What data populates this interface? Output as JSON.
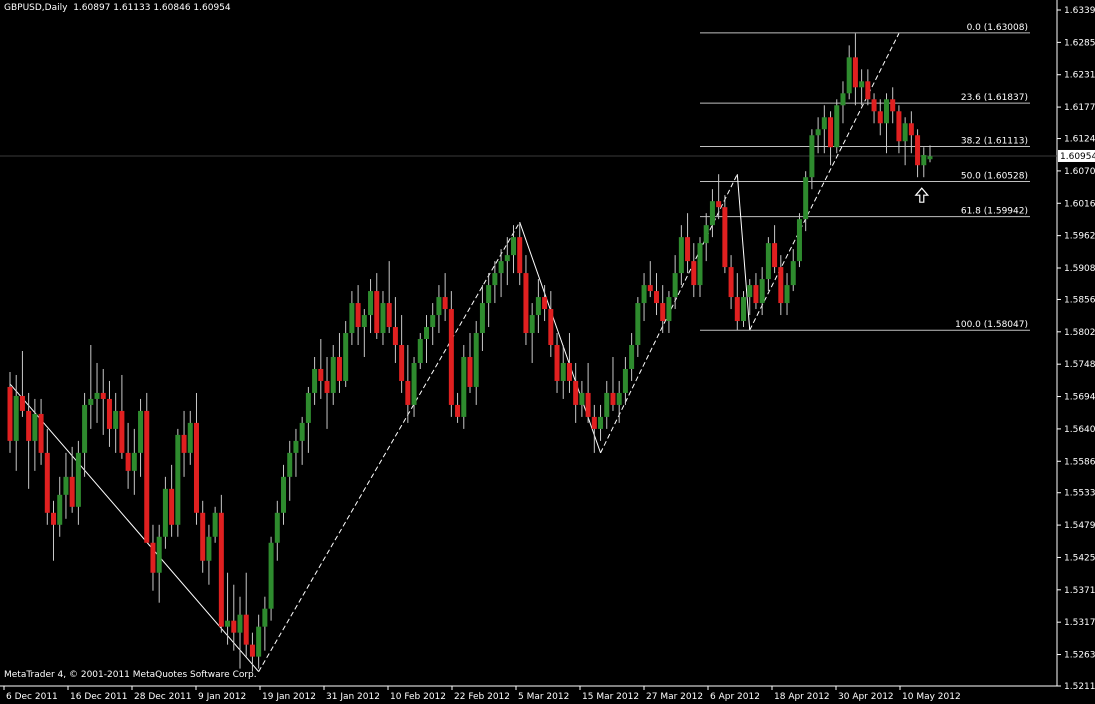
{
  "header": {
    "symbol": "GBPUSD,Daily",
    "ohlc": "1.60897 1.61133 1.60846 1.60954"
  },
  "footer": {
    "copyright": "MetaTrader 4, © 2001-2011 MetaQuotes Software Corp."
  },
  "colors": {
    "background": "#000000",
    "bull": "#2e8b2e",
    "bear": "#e02020",
    "wick": "#c8c8c8",
    "axis": "#ffffff",
    "fib": "#c0c0c0",
    "zigzag": "#ffffff",
    "price_line": "#3a3a3a"
  },
  "chart_data": {
    "type": "candlestick",
    "symbol": "GBPUSD",
    "timeframe": "Daily",
    "grid": false,
    "ylim": [
      1.5211,
      1.6339
    ],
    "y_ticks": [
      "1.63390",
      "1.62850",
      "1.62310",
      "1.61770",
      "1.61245",
      "1.60705",
      "1.60165",
      "1.59625",
      "1.59085",
      "1.58560",
      "1.58020",
      "1.57480",
      "1.56940",
      "1.56400",
      "1.55860",
      "1.55335",
      "1.54795",
      "1.54255",
      "1.53715",
      "1.53175",
      "1.52635",
      "1.52110"
    ],
    "x_ticks": [
      "6 Dec 2011",
      "16 Dec 2011",
      "28 Dec 2011",
      "9 Jan 2012",
      "19 Jan 2012",
      "31 Jan 2012",
      "10 Feb 2012",
      "22 Feb 2012",
      "5 Mar 2012",
      "15 Mar 2012",
      "27 Mar 2012",
      "6 Apr 2012",
      "18 Apr 2012",
      "30 Apr 2012",
      "10 May 2012"
    ],
    "current_price": "1.60954",
    "fibonacci": [
      {
        "label": "0.0 (1.63008)",
        "price": 1.63008
      },
      {
        "label": "23.6 (1.61837)",
        "price": 1.61837
      },
      {
        "label": "38.2 (1.61113)",
        "price": 1.61113
      },
      {
        "label": "50.0 (1.60528)",
        "price": 1.60528
      },
      {
        "label": "61.8 (1.59942)",
        "price": 1.59942
      },
      {
        "label": "100.0 (1.58047)",
        "price": 1.58047
      }
    ],
    "zigzag": [
      {
        "bar": 0,
        "price": 1.5715
      },
      {
        "bar": 40,
        "price": 1.5235
      },
      {
        "bar": 82,
        "price": 1.5985
      },
      {
        "bar": 95,
        "price": 1.56
      },
      {
        "bar": 117,
        "price": 1.6065
      },
      {
        "bar": 119,
        "price": 1.5805
      },
      {
        "bar": 143,
        "price": 1.63
      }
    ],
    "candles": [
      [
        1.571,
        1.5735,
        1.56,
        1.562
      ],
      [
        1.562,
        1.573,
        1.557,
        1.5695
      ],
      [
        1.5695,
        1.577,
        1.566,
        1.567
      ],
      [
        1.567,
        1.57,
        1.554,
        1.562
      ],
      [
        1.562,
        1.569,
        1.557,
        1.5665
      ],
      [
        1.5665,
        1.569,
        1.558,
        1.56
      ],
      [
        1.56,
        1.564,
        1.548,
        1.55
      ],
      [
        1.55,
        1.552,
        1.542,
        1.548
      ],
      [
        1.548,
        1.556,
        1.546,
        1.553
      ],
      [
        1.553,
        1.56,
        1.549,
        1.556
      ],
      [
        1.556,
        1.561,
        1.55,
        1.551
      ],
      [
        1.551,
        1.562,
        1.548,
        1.56
      ],
      [
        1.56,
        1.57,
        1.556,
        1.568
      ],
      [
        1.568,
        1.578,
        1.564,
        1.569
      ],
      [
        1.569,
        1.575,
        1.565,
        1.57
      ],
      [
        1.57,
        1.574,
        1.563,
        1.569
      ],
      [
        1.569,
        1.572,
        1.561,
        1.564
      ],
      [
        1.564,
        1.57,
        1.56,
        1.567
      ],
      [
        1.567,
        1.573,
        1.559,
        1.56
      ],
      [
        1.56,
        1.565,
        1.554,
        1.557
      ],
      [
        1.557,
        1.564,
        1.553,
        1.56
      ],
      [
        1.56,
        1.569,
        1.556,
        1.567
      ],
      [
        1.567,
        1.57,
        1.554,
        1.545
      ],
      [
        1.545,
        1.548,
        1.537,
        1.54
      ],
      [
        1.54,
        1.548,
        1.535,
        1.546
      ],
      [
        1.546,
        1.556,
        1.544,
        1.554
      ],
      [
        1.554,
        1.558,
        1.546,
        1.548
      ],
      [
        1.548,
        1.564,
        1.546,
        1.563
      ],
      [
        1.563,
        1.567,
        1.556,
        1.56
      ],
      [
        1.56,
        1.567,
        1.558,
        1.565
      ],
      [
        1.565,
        1.57,
        1.548,
        1.55
      ],
      [
        1.55,
        1.552,
        1.54,
        1.542
      ],
      [
        1.542,
        1.548,
        1.538,
        1.546
      ],
      [
        1.546,
        1.551,
        1.545,
        1.55
      ],
      [
        1.55,
        1.553,
        1.53,
        1.531
      ],
      [
        1.531,
        1.54,
        1.528,
        1.532
      ],
      [
        1.532,
        1.538,
        1.527,
        1.53
      ],
      [
        1.53,
        1.536,
        1.524,
        1.533
      ],
      [
        1.533,
        1.54,
        1.526,
        1.528
      ],
      [
        1.528,
        1.53,
        1.5235,
        1.526
      ],
      [
        1.526,
        1.533,
        1.524,
        1.531
      ],
      [
        1.531,
        1.536,
        1.527,
        1.534
      ],
      [
        1.534,
        1.546,
        1.532,
        1.545
      ],
      [
        1.545,
        1.552,
        1.542,
        1.55
      ],
      [
        1.55,
        1.558,
        1.548,
        1.556
      ],
      [
        1.556,
        1.562,
        1.552,
        1.56
      ],
      [
        1.56,
        1.564,
        1.556,
        1.562
      ],
      [
        1.562,
        1.566,
        1.558,
        1.565
      ],
      [
        1.565,
        1.571,
        1.56,
        1.57
      ],
      [
        1.57,
        1.576,
        1.568,
        1.574
      ],
      [
        1.574,
        1.579,
        1.569,
        1.572
      ],
      [
        1.572,
        1.576,
        1.564,
        1.57
      ],
      [
        1.57,
        1.578,
        1.568,
        1.576
      ],
      [
        1.576,
        1.58,
        1.57,
        1.572
      ],
      [
        1.572,
        1.582,
        1.571,
        1.58
      ],
      [
        1.58,
        1.587,
        1.578,
        1.585
      ],
      [
        1.585,
        1.588,
        1.578,
        1.581
      ],
      [
        1.581,
        1.584,
        1.576,
        1.583
      ],
      [
        1.583,
        1.589,
        1.58,
        1.587
      ],
      [
        1.587,
        1.59,
        1.579,
        1.58
      ],
      [
        1.58,
        1.587,
        1.578,
        1.585
      ],
      [
        1.585,
        1.592,
        1.58,
        1.581
      ],
      [
        1.581,
        1.586,
        1.575,
        1.578
      ],
      [
        1.578,
        1.583,
        1.57,
        1.572
      ],
      [
        1.572,
        1.578,
        1.565,
        1.568
      ],
      [
        1.568,
        1.576,
        1.566,
        1.575
      ],
      [
        1.575,
        1.58,
        1.574,
        1.579
      ],
      [
        1.579,
        1.583,
        1.575,
        1.581
      ],
      [
        1.581,
        1.585,
        1.578,
        1.583
      ],
      [
        1.583,
        1.588,
        1.58,
        1.586
      ],
      [
        1.586,
        1.59,
        1.582,
        1.584
      ],
      [
        1.584,
        1.587,
        1.566,
        1.568
      ],
      [
        1.568,
        1.57,
        1.565,
        1.566
      ],
      [
        1.566,
        1.578,
        1.564,
        1.576
      ],
      [
        1.576,
        1.58,
        1.57,
        1.571
      ],
      [
        1.571,
        1.582,
        1.568,
        1.58
      ],
      [
        1.58,
        1.588,
        1.577,
        1.585
      ],
      [
        1.585,
        1.59,
        1.581,
        1.588
      ],
      [
        1.588,
        1.592,
        1.585,
        1.59
      ],
      [
        1.59,
        1.594,
        1.586,
        1.592
      ],
      [
        1.592,
        1.596,
        1.588,
        1.593
      ],
      [
        1.593,
        1.598,
        1.59,
        1.596
      ],
      [
        1.596,
        1.5985,
        1.588,
        1.59
      ],
      [
        1.59,
        1.593,
        1.578,
        1.58
      ],
      [
        1.58,
        1.585,
        1.575,
        1.583
      ],
      [
        1.583,
        1.589,
        1.58,
        1.586
      ],
      [
        1.586,
        1.588,
        1.582,
        1.584
      ],
      [
        1.584,
        1.587,
        1.576,
        1.578
      ],
      [
        1.578,
        1.58,
        1.57,
        1.572
      ],
      [
        1.572,
        1.578,
        1.569,
        1.575
      ],
      [
        1.575,
        1.58,
        1.57,
        1.572
      ],
      [
        1.572,
        1.575,
        1.565,
        1.568
      ],
      [
        1.568,
        1.572,
        1.566,
        1.57
      ],
      [
        1.57,
        1.575,
        1.565,
        1.566
      ],
      [
        1.566,
        1.568,
        1.56,
        1.564
      ],
      [
        1.564,
        1.568,
        1.562,
        1.566
      ],
      [
        1.566,
        1.572,
        1.564,
        1.57
      ],
      [
        1.57,
        1.576,
        1.567,
        1.568
      ],
      [
        1.568,
        1.572,
        1.565,
        1.57
      ],
      [
        1.57,
        1.576,
        1.568,
        1.574
      ],
      [
        1.574,
        1.58,
        1.572,
        1.578
      ],
      [
        1.578,
        1.586,
        1.576,
        1.585
      ],
      [
        1.585,
        1.59,
        1.582,
        1.588
      ],
      [
        1.588,
        1.592,
        1.586,
        1.587
      ],
      [
        1.587,
        1.59,
        1.583,
        1.585
      ],
      [
        1.585,
        1.588,
        1.58,
        1.582
      ],
      [
        1.582,
        1.587,
        1.58,
        1.586
      ],
      [
        1.586,
        1.593,
        1.584,
        1.59
      ],
      [
        1.59,
        1.598,
        1.588,
        1.596
      ],
      [
        1.596,
        1.6,
        1.59,
        1.592
      ],
      [
        1.592,
        1.595,
        1.586,
        1.588
      ],
      [
        1.588,
        1.596,
        1.586,
        1.595
      ],
      [
        1.595,
        1.6,
        1.592,
        1.598
      ],
      [
        1.598,
        1.604,
        1.596,
        1.602
      ],
      [
        1.602,
        1.6065,
        1.599,
        1.601
      ],
      [
        1.601,
        1.603,
        1.59,
        1.591
      ],
      [
        1.591,
        1.593,
        1.584,
        1.586
      ],
      [
        1.586,
        1.59,
        1.5805,
        1.582
      ],
      [
        1.582,
        1.587,
        1.581,
        1.586
      ],
      [
        1.586,
        1.589,
        1.583,
        1.588
      ],
      [
        1.588,
        1.59,
        1.584,
        1.585
      ],
      [
        1.585,
        1.591,
        1.583,
        1.589
      ],
      [
        1.589,
        1.596,
        1.587,
        1.595
      ],
      [
        1.595,
        1.598,
        1.59,
        1.591
      ],
      [
        1.591,
        1.593,
        1.583,
        1.585
      ],
      [
        1.585,
        1.59,
        1.583,
        1.588
      ],
      [
        1.588,
        1.594,
        1.587,
        1.592
      ],
      [
        1.592,
        1.6,
        1.591,
        1.599
      ],
      [
        1.599,
        1.607,
        1.597,
        1.606
      ],
      [
        1.606,
        1.614,
        1.604,
        1.613
      ],
      [
        1.613,
        1.616,
        1.61,
        1.614
      ],
      [
        1.614,
        1.618,
        1.61,
        1.616
      ],
      [
        1.616,
        1.617,
        1.608,
        1.611
      ],
      [
        1.611,
        1.619,
        1.61,
        1.618
      ],
      [
        1.618,
        1.622,
        1.615,
        1.62
      ],
      [
        1.62,
        1.628,
        1.619,
        1.626
      ],
      [
        1.626,
        1.63,
        1.618,
        1.621
      ],
      [
        1.621,
        1.624,
        1.618,
        1.622
      ],
      [
        1.622,
        1.624,
        1.618,
        1.619
      ],
      [
        1.619,
        1.62,
        1.615,
        1.617
      ],
      [
        1.617,
        1.619,
        1.613,
        1.615
      ],
      [
        1.615,
        1.62,
        1.61,
        1.619
      ],
      [
        1.619,
        1.621,
        1.615,
        1.617
      ],
      [
        1.617,
        1.618,
        1.61,
        1.612
      ],
      [
        1.612,
        1.616,
        1.608,
        1.615
      ],
      [
        1.615,
        1.617,
        1.61,
        1.613
      ],
      [
        1.613,
        1.614,
        1.606,
        1.608
      ],
      [
        1.608,
        1.611,
        1.606,
        1.6097
      ],
      [
        1.609,
        1.6113,
        1.6085,
        1.6095
      ]
    ]
  }
}
